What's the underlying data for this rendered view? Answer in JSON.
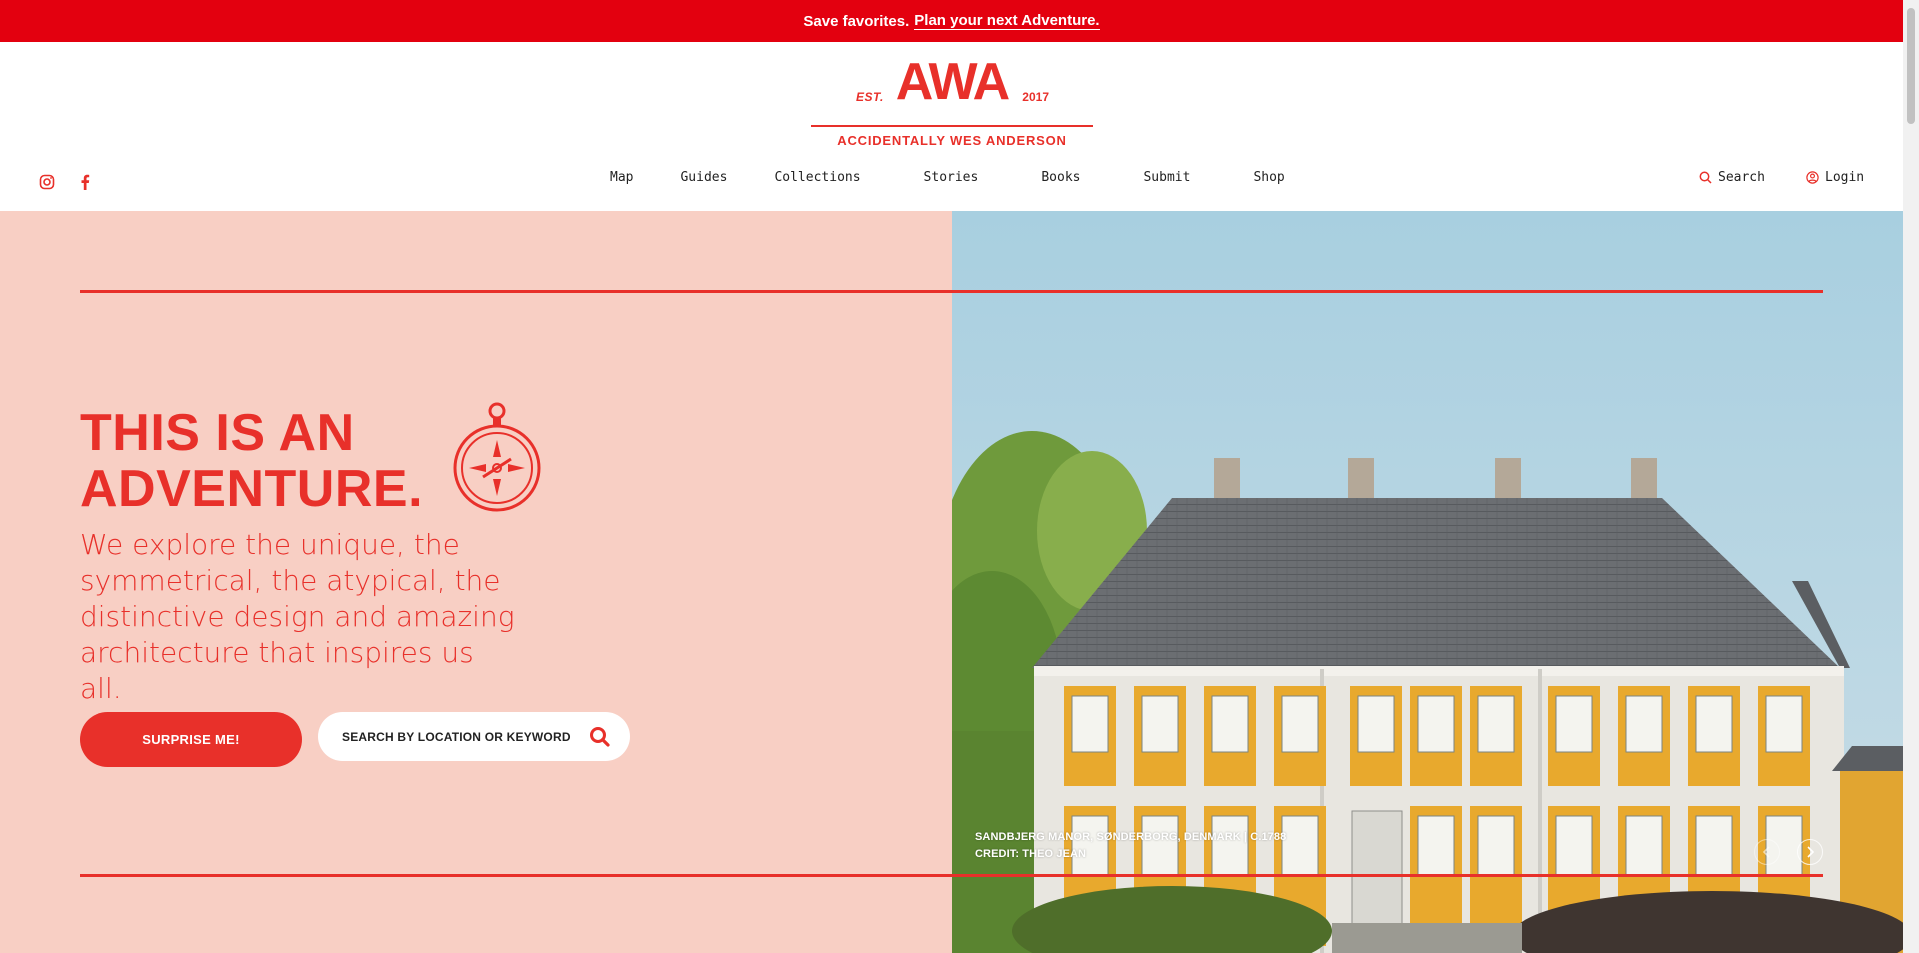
{
  "promo": {
    "text": "Save favorites.",
    "link": "Plan your next Adventure."
  },
  "logo": {
    "est": "EST.",
    "mark": "AWA",
    "year": "2017",
    "name": "ACCIDENTALLY WES ANDERSON"
  },
  "social": [
    "instagram-icon",
    "facebook-icon"
  ],
  "nav": [
    "Map",
    "Guides",
    "Collections",
    "Stories",
    "Books",
    "Submit",
    "Shop"
  ],
  "util": {
    "search": "Search",
    "login": "Login"
  },
  "hero": {
    "headline_line1": "THIS IS AN",
    "headline_line2": "ADVENTURE.",
    "description": "We explore the unique, the symmetrical, the atypical, the distinctive design and amazing architecture that inspires us all.",
    "surprise_button": "SURPRISE ME!",
    "search_placeholder": "SEARCH BY LOCATION OR KEYWORD",
    "caption_line1": "SANDBJERG MANOR, SØNDERBORG, DENMARK | C.1788",
    "caption_line2": "CREDIT: THEO JEAN"
  },
  "colors": {
    "brand_red": "#e8302a",
    "promo_red": "#e3000f",
    "hero_pink": "#f8cfc4"
  }
}
